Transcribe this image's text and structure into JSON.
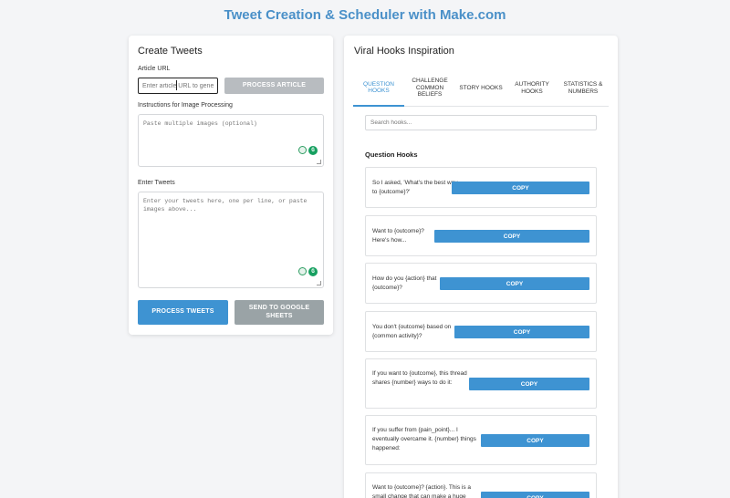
{
  "app_title": "Tweet Creation & Scheduler with Make.com",
  "left_panel": {
    "title": "Create Tweets",
    "article_url_label": "Article URL",
    "article_url_placeholder": "Enter article URL to genera",
    "process_article_label": "PROCESS ARTICLE",
    "image_instructions_label": "Instructions for Image Processing",
    "image_instructions_placeholder": "Paste multiple images (optional)",
    "tweets_label": "Enter Tweets",
    "tweets_placeholder": "Enter your tweets here, one per line, or paste images above...",
    "process_tweets_label": "PROCESS TWEETS",
    "send_sheets_label": "SEND TO GOOGLE SHEETS"
  },
  "right_panel": {
    "title": "Viral Hooks Inspiration",
    "tabs": [
      {
        "label": "QUESTION HOOKS",
        "active": true
      },
      {
        "label": "CHALLENGE COMMON BELIEFS",
        "active": false
      },
      {
        "label": "STORY HOOKS",
        "active": false
      },
      {
        "label": "AUTHORITY HOOKS",
        "active": false
      },
      {
        "label": "STATISTICS & NUMBERS",
        "active": false
      }
    ],
    "search_placeholder": "Search hooks...",
    "section_heading": "Question Hooks",
    "copy_label": "COPY",
    "hooks": [
      "So I asked, 'What's the best way to {outcome}?'",
      "Want to {outcome}? Here's how...",
      "How do you {action} that {outcome}?",
      "You don't {outcome} based on {common activity}?",
      "If you want to {outcome}, this thread shares {number} ways to do it:",
      "If you suffer from {pain_point}... I eventually overcame it. {number} things happened:",
      "Want to {outcome}? {action}. This is a small change that can make a huge"
    ]
  },
  "colors": {
    "accent": "#3e93d2",
    "title": "#4a90c8",
    "disabled": "#b8bcc0",
    "secondary": "#9aa3a6"
  }
}
